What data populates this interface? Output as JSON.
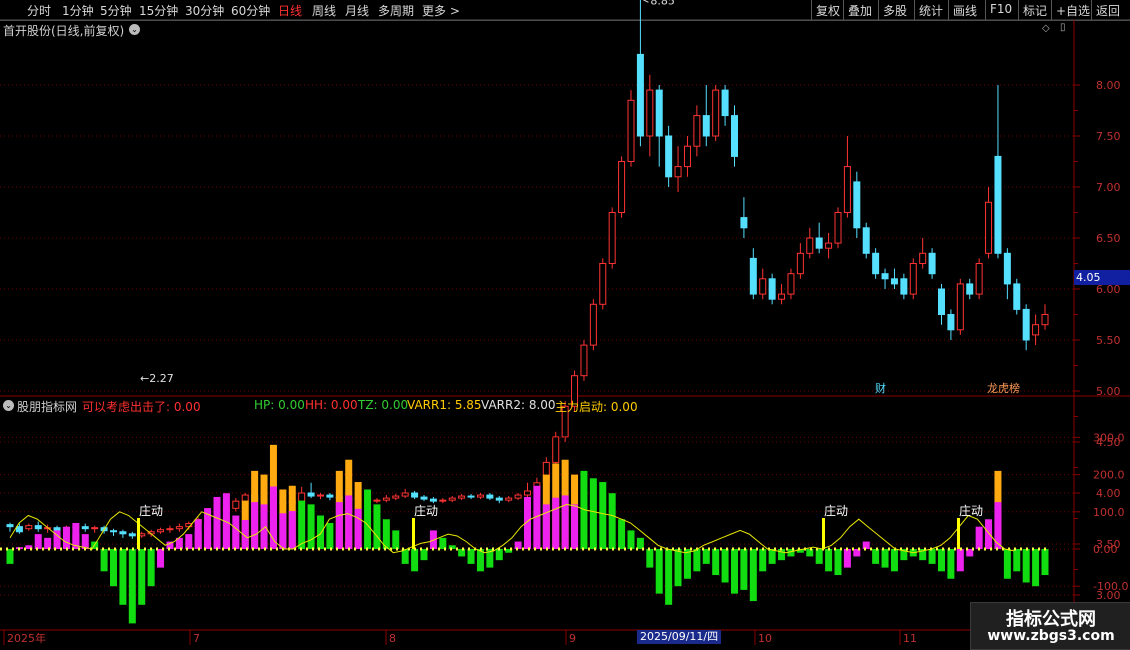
{
  "toolbar": {
    "left_items": [
      "分时",
      "1分钟",
      "5分钟",
      "15分钟",
      "30分钟",
      "60分钟",
      "日线",
      "周线",
      "月线",
      "多周期",
      "更多 >"
    ],
    "active": "日线",
    "right_items": [
      "复权",
      "叠加",
      "多股",
      "统计",
      "画线",
      "F10",
      "标记",
      "+自选",
      "返回"
    ]
  },
  "chart": {
    "title": "首开股份(日线,前复权)",
    "high_label": "8.85",
    "low_label": "2.27",
    "current_price": "4.05",
    "price_ticks": [
      "8.00",
      "7.50",
      "7.00",
      "6.50",
      "6.00",
      "5.50",
      "5.00",
      "4.50",
      "4.00",
      "3.50",
      "3.00"
    ],
    "markers": [
      "财",
      "龙虎榜"
    ],
    "colors": {
      "up": "#ff3333",
      "down": "#55e0ff",
      "grid": "#6b0000"
    }
  },
  "indicator": {
    "name": "股朋指标网",
    "items": [
      {
        "text": "可以考虑出击了: 0.00",
        "color": "#ff3030"
      },
      {
        "text": "HP: 0.00",
        "color": "#33cc33"
      },
      {
        "text": "HH: 0.00",
        "color": "#ff3030"
      },
      {
        "text": "TZ: 0.00",
        "color": "#33cc33"
      },
      {
        "text": "VARR1: 5.85",
        "color": "#ffcc00"
      },
      {
        "text": "VARR2: 8.00",
        "color": "#e0e0e0"
      },
      {
        "text": "主力启动: 0.00",
        "color": "#ffcc00"
      }
    ],
    "y_ticks": [
      "300.0",
      "200.0",
      "100.0",
      "0.00",
      "-100.0"
    ],
    "zhuangdong_label": "庄动",
    "colors": {
      "green": "#11dd11",
      "magenta": "#ee22ee",
      "orange": "#ffaa11",
      "line": "#ffff44"
    }
  },
  "x_axis": {
    "labels": [
      "2025年",
      "7",
      "8",
      "9",
      "10",
      "11"
    ],
    "cursor_date": "2025/09/11/四"
  },
  "watermark": {
    "title": "指标公式网",
    "url": "www.zbgs3.com"
  }
}
